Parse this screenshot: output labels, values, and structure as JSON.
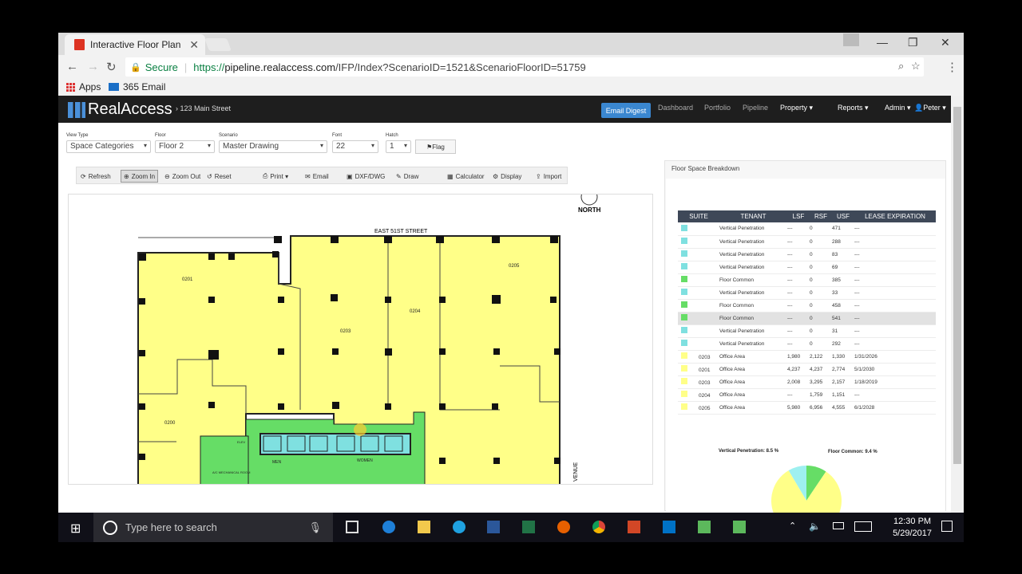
{
  "browser": {
    "tab_title": "Interactive Floor Plan",
    "secure_label": "Secure",
    "url_scheme": "https://",
    "url_host": "pipeline.realaccess.com",
    "url_path": "/IFP/Index?ScenarioID=1521&ScenarioFloorID=51759",
    "bookmarks": [
      "Apps",
      "365 Email"
    ]
  },
  "app": {
    "logo": "RealAccess",
    "breadcrumb": "123 Main Street",
    "nav": [
      "Email Digest",
      "Dashboard",
      "Portfolio",
      "Pipeline",
      "Property ▾",
      "Reports ▾",
      "Admin ▾",
      "Peter ▾"
    ]
  },
  "filters": {
    "labels": [
      "View Type",
      "Floor",
      "Scenario",
      "Font",
      "Hatch"
    ],
    "values": [
      "Space Categories",
      "Floor 2",
      "Master Drawing",
      "22",
      "1"
    ],
    "flag": "Flag"
  },
  "toolbar": [
    "Refresh",
    "Zoom In",
    "Zoom Out",
    "Reset",
    "Print ▾",
    "Email",
    "DXF/DWG",
    "Draw",
    "Calculator",
    "Display",
    "Import"
  ],
  "plan": {
    "north": "NORTH",
    "street": "EAST 51ST STREET",
    "avenue": "VENUE",
    "suites": [
      "0201",
      "0203",
      "0204",
      "0205",
      "0200"
    ],
    "rooms": [
      "MEN",
      "WOMEN",
      "A/C MECHANICAL ROOM",
      "ELEV"
    ]
  },
  "panel": {
    "title": "Floor Space Breakdown",
    "columns": [
      "SUITE",
      "TENANT",
      "LSF",
      "RSF",
      "USF",
      "LEASE EXPIRATION"
    ],
    "rows": [
      [
        "",
        "Vertical Penetration",
        "---",
        "0",
        "471",
        "---"
      ],
      [
        "",
        "Vertical Penetration",
        "---",
        "0",
        "288",
        "---"
      ],
      [
        "",
        "Vertical Penetration",
        "---",
        "0",
        "83",
        "---"
      ],
      [
        "",
        "Vertical Penetration",
        "---",
        "0",
        "69",
        "---"
      ],
      [
        "",
        "Floor Common",
        "---",
        "0",
        "385",
        "---"
      ],
      [
        "",
        "Vertical Penetration",
        "---",
        "0",
        "33",
        "---"
      ],
      [
        "",
        "Floor Common",
        "---",
        "0",
        "458",
        "---"
      ],
      [
        "",
        "Floor Common",
        "---",
        "0",
        "541",
        "---"
      ],
      [
        "",
        "Vertical Penetration",
        "---",
        "0",
        "31",
        "---"
      ],
      [
        "",
        "Vertical Penetration",
        "---",
        "0",
        "292",
        "---"
      ],
      [
        "0203",
        "Office Area",
        "1,980",
        "2,122",
        "1,330",
        "1/31/2026"
      ],
      [
        "0201",
        "Office Area",
        "4,237",
        "4,237",
        "2,774",
        "5/1/2030"
      ],
      [
        "0203",
        "Office Area",
        "2,008",
        "3,295",
        "2,157",
        "1/18/2019"
      ],
      [
        "0204",
        "Office Area",
        "---",
        "1,759",
        "1,151",
        "---"
      ],
      [
        "0205",
        "Office Area",
        "5,980",
        "6,956",
        "4,555",
        "6/1/2028"
      ]
    ],
    "row_colors": [
      "#7fe0e0",
      "#7fe0e0",
      "#7fe0e0",
      "#7fe0e0",
      "#66dd66",
      "#7fe0e0",
      "#66dd66",
      "#66dd66",
      "#7fe0e0",
      "#7fe0e0",
      "#ffff88",
      "#ffff88",
      "#ffff88",
      "#ffff88",
      "#ffff88"
    ],
    "pie_labels": [
      "Vertical Penetration: 8.5 %",
      "Floor Common: 9.4 %"
    ],
    "pie_values": [
      8.5,
      9.4,
      82.1
    ]
  },
  "taskbar": {
    "search": "Type here to search",
    "time": "12:30 PM",
    "date": "5/29/2017"
  }
}
